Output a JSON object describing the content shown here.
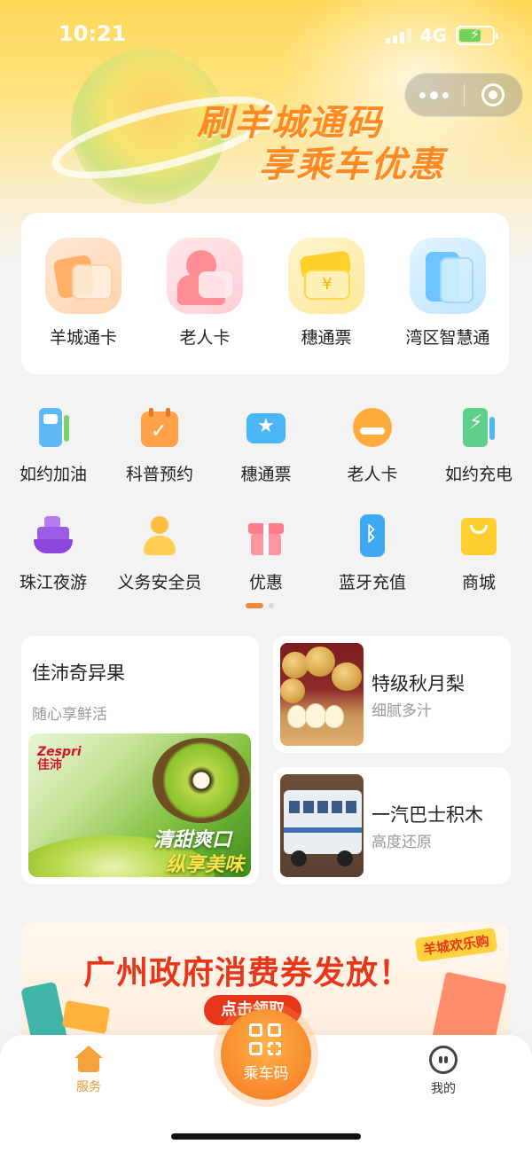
{
  "status_bar": {
    "time": "10:21",
    "network": "4G"
  },
  "hero": {
    "slogan_line1": "刷羊城通码",
    "slogan_line2": "享乘车优惠"
  },
  "capsule": {
    "more_icon": "more-dots-icon",
    "close_icon": "target-circle-icon"
  },
  "main_services": [
    {
      "label": "羊城通卡",
      "icon": "card-icon"
    },
    {
      "label": "老人卡",
      "icon": "elder-card-icon"
    },
    {
      "label": "穗通票",
      "icon": "ticket-icon"
    },
    {
      "label": "湾区智慧通",
      "icon": "bay-card-icon"
    }
  ],
  "grid_services": [
    {
      "label": "如约加油",
      "icon": "fuel-pump-icon"
    },
    {
      "label": "科普预约",
      "icon": "calendar-check-icon"
    },
    {
      "label": "穗通票",
      "icon": "star-ticket-icon"
    },
    {
      "label": "老人卡",
      "icon": "elder-face-icon"
    },
    {
      "label": "如约充电",
      "icon": "charging-station-icon"
    },
    {
      "label": "珠江夜游",
      "icon": "cruise-ship-icon"
    },
    {
      "label": "义务安全员",
      "icon": "person-icon"
    },
    {
      "label": "优惠",
      "icon": "gift-icon"
    },
    {
      "label": "蓝牙充值",
      "icon": "bluetooth-icon"
    },
    {
      "label": "商城",
      "icon": "shopping-bag-icon"
    }
  ],
  "pager": {
    "current": 1,
    "total": 2
  },
  "promos": {
    "kiwi": {
      "title": "佳沛奇异果",
      "subtitle": "随心享鲜活",
      "brand": "Zespri",
      "brand_cn": "佳沛",
      "tag1": "清甜爽口",
      "tag2": "纵享美味"
    },
    "pear": {
      "title": "特级秋月梨",
      "subtitle": "细腻多汁"
    },
    "bus": {
      "title": "一汽巴士积木",
      "subtitle": "高度还原"
    }
  },
  "banner": {
    "title": "广州政府消费券发放！",
    "tag": "羊城欢乐购",
    "button": "点击领取"
  },
  "tabbar": {
    "service": "服务",
    "scan": "乘车码",
    "mine": "我的"
  },
  "colors": {
    "accent": "#f7882c",
    "hero_yellow": "#ffd85a",
    "slogan": "#ff8a22",
    "banner_red": "#e8361b"
  }
}
